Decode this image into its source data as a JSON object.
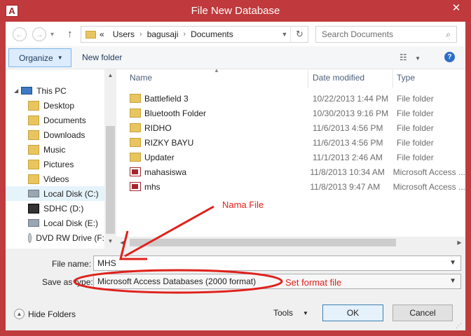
{
  "window": {
    "title": "File New Database",
    "app_icon_letter": "A",
    "close_glyph": "✕"
  },
  "address": {
    "overflow": "«",
    "crumbs": [
      "Users",
      "bagusaji",
      "Documents"
    ],
    "search_placeholder": "Search Documents"
  },
  "toolbar": {
    "organize_label": "Organize",
    "new_folder_label": "New folder"
  },
  "nav_pane": {
    "items": [
      {
        "label": "This PC",
        "icon": "computer-icon"
      },
      {
        "label": "Desktop",
        "icon": "folder-icon"
      },
      {
        "label": "Documents",
        "icon": "folder-icon"
      },
      {
        "label": "Downloads",
        "icon": "folder-icon"
      },
      {
        "label": "Music",
        "icon": "folder-icon"
      },
      {
        "label": "Pictures",
        "icon": "folder-icon"
      },
      {
        "label": "Videos",
        "icon": "folder-icon"
      },
      {
        "label": "Local Disk (C:)",
        "icon": "drive-icon"
      },
      {
        "label": "SDHC (D:)",
        "icon": "sd-card-icon"
      },
      {
        "label": "Local Disk (E:)",
        "icon": "drive-icon"
      },
      {
        "label": "DVD RW Drive (F:",
        "icon": "dvd-icon"
      }
    ],
    "selected": "Local Disk (C:)"
  },
  "file_list": {
    "columns": {
      "name": "Name",
      "date": "Date modified",
      "type": "Type"
    },
    "rows": [
      {
        "name": "Battlefield 3",
        "date": "10/22/2013 1:44 PM",
        "type": "File folder",
        "icon": "folder-icon"
      },
      {
        "name": "Bluetooth Folder",
        "date": "10/30/2013 9:16 PM",
        "type": "File folder",
        "icon": "folder-icon"
      },
      {
        "name": "RIDHO",
        "date": "11/6/2013 4:56 PM",
        "type": "File folder",
        "icon": "folder-icon"
      },
      {
        "name": "RIZKY BAYU",
        "date": "11/6/2013 4:56 PM",
        "type": "File folder",
        "icon": "folder-icon"
      },
      {
        "name": "Updater",
        "date": "11/1/2013 2:46 AM",
        "type": "File folder",
        "icon": "folder-icon"
      },
      {
        "name": "mahasiswa",
        "date": "11/8/2013 10:34 AM",
        "type": "Microsoft Access ...",
        "icon": "access-db-icon"
      },
      {
        "name": "mhs",
        "date": "11/8/2013 9:47 AM",
        "type": "Microsoft Access ...",
        "icon": "access-db-icon"
      }
    ]
  },
  "form": {
    "file_name_label": "File name:",
    "file_name_value": "MHS",
    "save_type_label": "Save as type:",
    "save_type_value": "Microsoft Access Databases (2000 format)"
  },
  "footer": {
    "hide_folders_label": "Hide Folders",
    "tools_label": "Tools",
    "ok_label": "OK",
    "cancel_label": "Cancel"
  },
  "annotations": {
    "file_name_note": "Nama File",
    "format_note": "Set format file",
    "color": "#e0201a"
  }
}
